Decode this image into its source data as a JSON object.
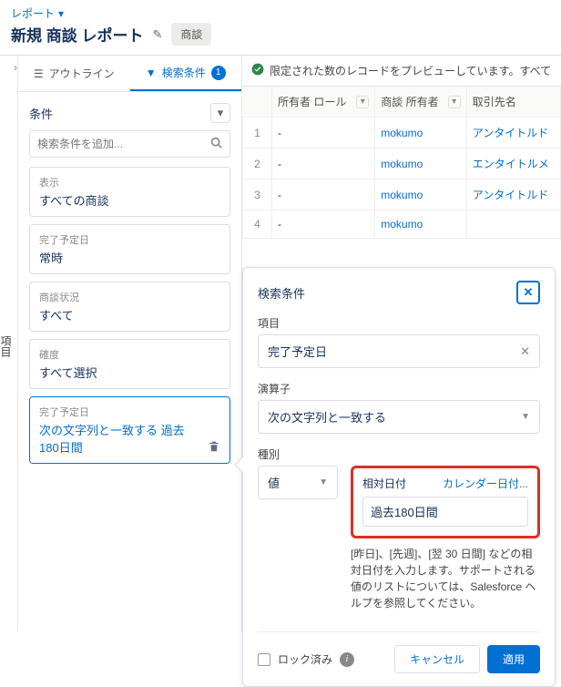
{
  "header": {
    "breadcrumb": "レポート",
    "title": "新規 商談 レポート",
    "chip": "商談"
  },
  "rail": {
    "label": "項目"
  },
  "tabs": {
    "outline": "アウトライン",
    "filters": "検索条件",
    "badge": "1"
  },
  "panel": {
    "heading": "条件",
    "search_placeholder": "検索条件を追加...",
    "cards": [
      {
        "label": "表示",
        "value": "すべての商談"
      },
      {
        "label": "完了予定日",
        "value": "常時"
      },
      {
        "label": "商談状況",
        "value": "すべて"
      },
      {
        "label": "確度",
        "value": "すべて選択"
      }
    ],
    "active_card": {
      "label": "完了予定日",
      "value": "次の文字列と一致する 過去180日間"
    }
  },
  "preview": {
    "banner": "限定された数のレコードをプレビューしています。すべて",
    "columns": [
      "所有者 ロール",
      "商談 所有者",
      "取引先名"
    ],
    "rows": [
      {
        "i": "1",
        "role": "-",
        "owner": "mokumo",
        "acct": "アンタイトルド"
      },
      {
        "i": "2",
        "role": "-",
        "owner": "mokumo",
        "acct": "エンタイトルメ"
      },
      {
        "i": "3",
        "role": "-",
        "owner": "mokumo",
        "acct": "アンタイトルド"
      },
      {
        "i": "4",
        "role": "-",
        "owner": "mokumo",
        "acct": ""
      }
    ]
  },
  "popover": {
    "title": "検索条件",
    "field_label": "項目",
    "field_value": "完了予定日",
    "op_label": "演算子",
    "op_value": "次の文字列と一致する",
    "type_label": "種別",
    "type_value": "値",
    "rel_date_label": "相対日付",
    "cal_date_label": "カレンダー日付...",
    "date_value": "過去180日間",
    "hint": "[昨日]、[先週]、[翌 30 日間] などの相対日付を入力します。サポートされる値のリストについては、Salesforce ヘルプを参照してください。",
    "lock_label": "ロック済み",
    "cancel": "キャンセル",
    "apply": "適用"
  }
}
